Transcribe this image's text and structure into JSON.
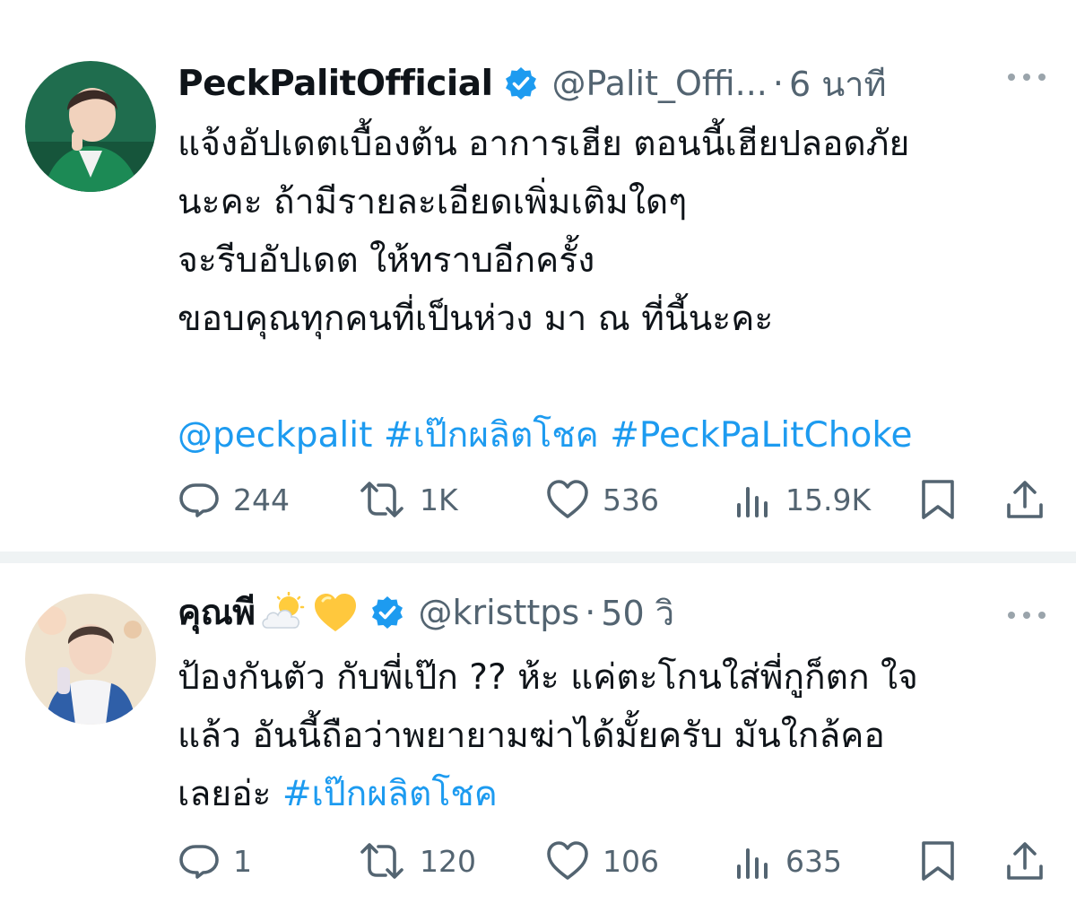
{
  "tweets": [
    {
      "name": "PeckPalitOfficial",
      "handle": "@Palit_Offi...",
      "dot": "·",
      "time": "6 นาที",
      "lines": [
        "แจ้งอัปเดตเบื้องต้น อาการเฮีย ตอนนี้เฮียปลอดภัย",
        "นะคะ ถ้ามีรายละเอียดเพิ่มเติมใดๆ",
        "จะรีบอัปเดต ให้ทราบอีกครั้ง",
        "ขอบคุณทุกคนที่เป็นห่วง มา ณ ที่นี้นะคะ"
      ],
      "tags": [
        "@peckpalit",
        "#เป๊กผลิตโชค",
        "#PeckPaLitChoke"
      ],
      "stats": {
        "replies": "244",
        "retweets": "1K",
        "likes": "536",
        "views": "15.9K"
      }
    },
    {
      "name": "คุณพี",
      "emojis": [
        "sun-behind-cloud-emoji",
        "yellow-heart-emoji"
      ],
      "handle": "@kristtps",
      "dot": "·",
      "time": "50 วิ",
      "lines": [
        "ป้องกันตัว กับพี่เป๊ก ?? ห้ะ แค่ตะโกนใส่พี่กูก็ตก ใจ",
        "แล้ว อันนี้ถือว่าพยายามฆ่าได้มั้ยครับ มันใกล้คอ"
      ],
      "last_line_text": "เลยอ่ะ ",
      "last_line_tag": "#เป๊กผลิตโชค",
      "stats": {
        "replies": "1",
        "retweets": "120",
        "likes": "106",
        "views": "635"
      }
    }
  ],
  "colors": {
    "link": "#1d9bf0",
    "muted": "#536471",
    "verified": "#1d9bf0",
    "separator": "#eff3f4"
  },
  "icons": [
    "verified-badge-icon",
    "more-options-icon",
    "reply-icon",
    "retweet-icon",
    "like-icon",
    "views-icon",
    "bookmark-icon",
    "share-icon"
  ]
}
